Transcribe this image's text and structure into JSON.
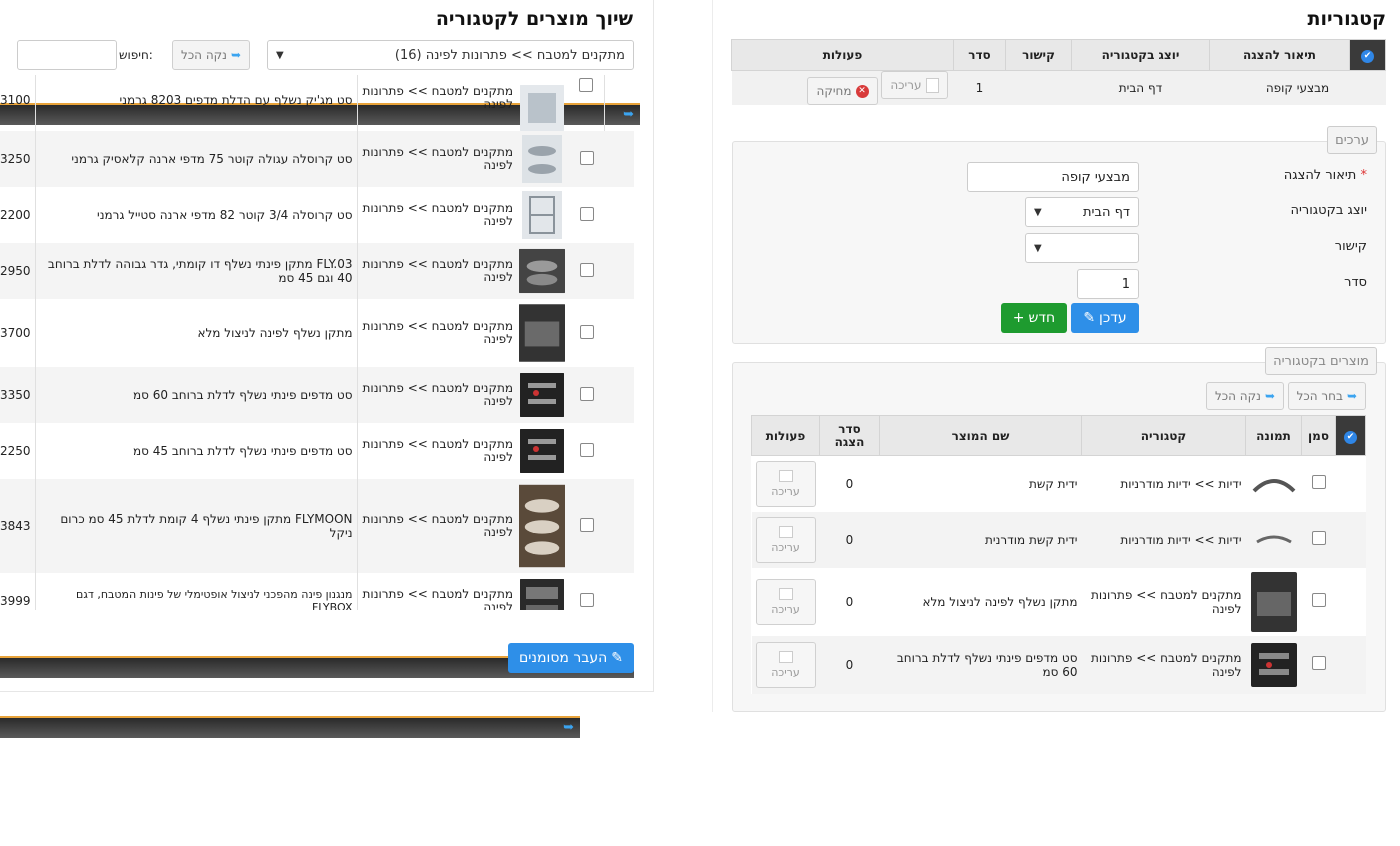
{
  "categories_panel": {
    "title": "קטגוריות",
    "table_headers": [
      "תיאור להצגה",
      "יוצג בקטגוריה",
      "קישור",
      "סדר",
      "פעולות"
    ],
    "rows": [
      {
        "description": "מבצעי קופה",
        "shown_in": "דף הבית",
        "link": "",
        "order": "1",
        "edit_label": "עריכה",
        "delete_label": "מחיקה"
      }
    ]
  },
  "values_form": {
    "tab_label": "ערכים",
    "required_mark": "*",
    "fields": {
      "description_label": "תיאור להצגה",
      "description_value": "מבצעי קופה",
      "shown_in_label": "יוצג בקטגוריה",
      "shown_in_value": "דף הבית",
      "link_label": "קישור",
      "link_value": "",
      "order_label": "סדר",
      "order_value": "1"
    },
    "update_button": "עדכן",
    "new_button": "חדש"
  },
  "category_products": {
    "tab_label": "מוצרים בקטגוריה",
    "select_all": "בחר הכל",
    "clear_all": "נקה הכל",
    "table_headers": [
      "סמן",
      "תמונה",
      "קטגוריה",
      "שם המוצר",
      "סדר הצגה",
      "פעולות"
    ],
    "rows": [
      {
        "category": "ידיות >> ידיות מודרניות",
        "name": "ידית קשת",
        "order": "0",
        "edit": "עריכה",
        "thumb": "handle"
      },
      {
        "category": "ידיות >> ידיות מודרניות",
        "name": "ידית קשת מודרנית",
        "order": "0",
        "edit": "עריכה",
        "thumb": "handle2"
      },
      {
        "category": "מתקנים למטבח >> פתרונות לפינה",
        "name": "מתקן נשלף לפינה לניצול מלא",
        "order": "0",
        "edit": "עריכה",
        "thumb": "dark"
      },
      {
        "category": "מתקנים למטבח >> פתרונות לפינה",
        "name": "סט מדפים פינתי נשלף לדלת ברוחב 60 סמ",
        "order": "0",
        "edit": "עריכה",
        "thumb": "wire"
      }
    ]
  },
  "assign_panel": {
    "title": "שיוך מוצרים לקטגוריה",
    "category_select": "מתקנים למטבח >> פתרונות לפינה (16)",
    "clear_all": "נקה הכל",
    "search_label": "חיפוש:",
    "search_value": "",
    "transfer_button": "העבר מסומנים",
    "rows": [
      {
        "category": "מתקנים למטבח >> פתרונות לפינה",
        "name": "סט מג'יק נשלף עם הדלת מדפים 8203 גרמני",
        "price": "3100",
        "thumb": "light"
      },
      {
        "category": "מתקנים למטבח >> פתרונות לפינה",
        "name": "סט קרוסלה עגולה קוטר 75 מדפי ארנה קלאסיק גרמני",
        "price": "3250",
        "thumb": "light"
      },
      {
        "category": "מתקנים למטבח >> פתרונות לפינה",
        "name": "סט קרוסלה 3/4 קוטר 82 מדפי ארנה סטייל גרמני",
        "price": "2200",
        "thumb": "light"
      },
      {
        "category": "מתקנים למטבח >> פתרונות לפינה",
        "name": "FLY.03 מתקן פינתי נשלף דו קומתי, גדר גבוהה לדלת ברוחב 40 וגם 45 סמ",
        "price": "2950",
        "thumb": "dark"
      },
      {
        "category": "מתקנים למטבח >> פתרונות לפינה",
        "name": "מתקן נשלף לפינה לניצול מלא",
        "price": "3700",
        "thumb": "dark"
      },
      {
        "category": "מתקנים למטבח >> פתרונות לפינה",
        "name": "סט מדפים פינתי נשלף לדלת ברוחב 60 סמ",
        "price": "3350",
        "thumb": "wire"
      },
      {
        "category": "מתקנים למטבח >> פתרונות לפינה",
        "name": "סט מדפים פינתי נשלף לדלת ברוחב 45 סמ",
        "price": "2250",
        "thumb": "wire"
      },
      {
        "category": "מתקנים למטבח >> פתרונות לפינה",
        "name": "FLYMOON מתקן פינתי נשלף 4 קומת לדלת 45 סמ כרום ניקל",
        "price": "3843",
        "thumb": "moon"
      },
      {
        "category": "מתקנים למטבח >> פתרונות לפינה",
        "name": "מנגנון פינה מהפכני לניצול אופטימלי של פינות המטבח, דגם FLYBOX",
        "price": "3999",
        "thumb": "dark"
      }
    ]
  }
}
